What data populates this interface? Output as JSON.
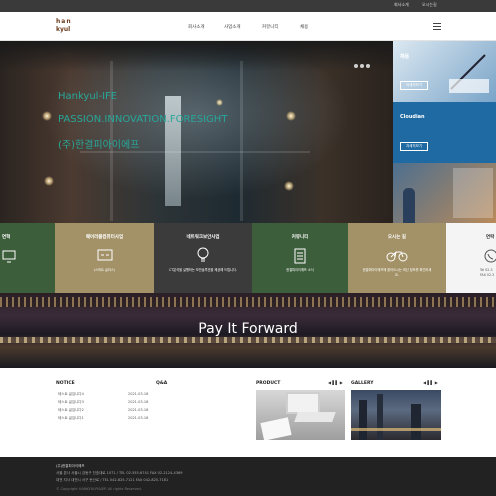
{
  "topbar": {
    "link1": "회사소개",
    "link2": "오시는길"
  },
  "header": {
    "logo_line1": "han",
    "logo_line2": "kyul",
    "nav": [
      "회사소개",
      "사업소개",
      "커뮤니티",
      "채용"
    ]
  },
  "hero": {
    "line1": "Hankyul-IFE",
    "line2": "PASSION.INNOVATION.FORESIGHT",
    "line3": "(주)한결피아이에프"
  },
  "side_panels": [
    {
      "title": "채용",
      "button": "자세히보기"
    },
    {
      "title": "Cloudian",
      "button": "자세히보기"
    },
    {
      "title": "",
      "button": ""
    }
  ],
  "tiles": [
    {
      "title": "연혁",
      "desc": "",
      "icon": "monitor-icon",
      "color": "#3d5e3b"
    },
    {
      "title": "웨어러블컴퓨터사업",
      "desc": "(스마트 글라스)",
      "icon": "glasses-icon",
      "color": "#a39267"
    },
    {
      "title": "네트워크보안사업",
      "desc": "CT분석을 실행하는 보안솔루션을 제공해 드립니다.",
      "icon": "bulb-icon",
      "color": "#3b3b3b"
    },
    {
      "title": "커뮤니티",
      "desc": "한결피아이에프 소식",
      "icon": "document-icon",
      "color": "#3d5e3b"
    },
    {
      "title": "오시는 길",
      "desc": "한결피아이에프에 찾아오시는 최신 정보를 확인하세요.",
      "icon": "bicycle-icon",
      "color": "#a39267"
    },
    {
      "title": "연락",
      "desc": "Tel 02-3 FAX 02-3",
      "icon": "phone-icon",
      "color": "#f4f4f4"
    }
  ],
  "pif": {
    "title": "Pay It Forward"
  },
  "notice": {
    "title": "NOTICE",
    "rows": [
      {
        "text": "테스트 글입니다4",
        "date": "2021-03-16"
      },
      {
        "text": "테스트 글입니다3",
        "date": "2021-03-16"
      },
      {
        "text": "테스트 글입니다2",
        "date": "2021-03-16"
      },
      {
        "text": "테스트 글입니다1",
        "date": "2021-03-16"
      }
    ]
  },
  "qna": {
    "title": "Q&A"
  },
  "product": {
    "title": "PRODUCT",
    "pager": "◀ ▌▌ ▶"
  },
  "gallery": {
    "title": "GALLERY",
    "pager": "◀ ▌▌ ▶"
  },
  "footer": {
    "company": "(주)한결피아이에프",
    "line1": "서울 본사  서울시 강동구 천호대로 1071 / TEL 02-555-6741  FAX 02-2124-4369",
    "line2": "대전 지사  대전시 서구 둔산로 / TEL 042-825-7121  FAX 042-825-7181",
    "copyright": "© Copyright HANKYULPIAIEP. All rights Reserved."
  }
}
